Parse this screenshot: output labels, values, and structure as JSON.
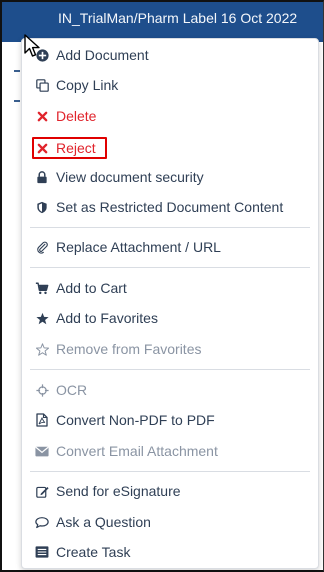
{
  "window": {
    "header_text": "IN_TrialMan/Pharm Label 16 Oct 2022"
  },
  "menu": {
    "items": [
      {
        "label": "Add Document",
        "icon": "plus-circle-icon",
        "state": "normal"
      },
      {
        "label": "Copy Link",
        "icon": "copy-icon",
        "state": "normal"
      },
      {
        "label": "Delete",
        "icon": "x-icon",
        "state": "danger"
      },
      {
        "label": "Reject",
        "icon": "x-icon",
        "state": "danger",
        "highlighted": true
      },
      {
        "label": "View document security",
        "icon": "lock-icon",
        "state": "normal"
      },
      {
        "label": "Set as Restricted Document Content",
        "icon": "shield-icon",
        "state": "normal"
      },
      {
        "label": "Replace Attachment / URL",
        "icon": "paperclip-icon",
        "state": "normal"
      },
      {
        "label": "Add to Cart",
        "icon": "cart-icon",
        "state": "normal"
      },
      {
        "label": "Add to Favorites",
        "icon": "star-filled-icon",
        "state": "normal"
      },
      {
        "label": "Remove from Favorites",
        "icon": "star-outline-icon",
        "state": "disabled"
      },
      {
        "label": "OCR",
        "icon": "crosshair-icon",
        "state": "disabled"
      },
      {
        "label": "Convert Non-PDF to PDF",
        "icon": "pdf-file-icon",
        "state": "normal"
      },
      {
        "label": "Convert Email Attachment",
        "icon": "envelope-icon",
        "state": "disabled"
      },
      {
        "label": "Send for eSignature",
        "icon": "edit-icon",
        "state": "normal"
      },
      {
        "label": "Ask a Question",
        "icon": "comment-icon",
        "state": "normal"
      },
      {
        "label": "Create Task",
        "icon": "task-list-icon",
        "state": "normal"
      }
    ]
  },
  "colors": {
    "header_bg": "#1e4e8c",
    "text": "#2f3f55",
    "danger": "#e0242c",
    "disabled": "#8a94a3",
    "highlight_border": "#e00000"
  }
}
